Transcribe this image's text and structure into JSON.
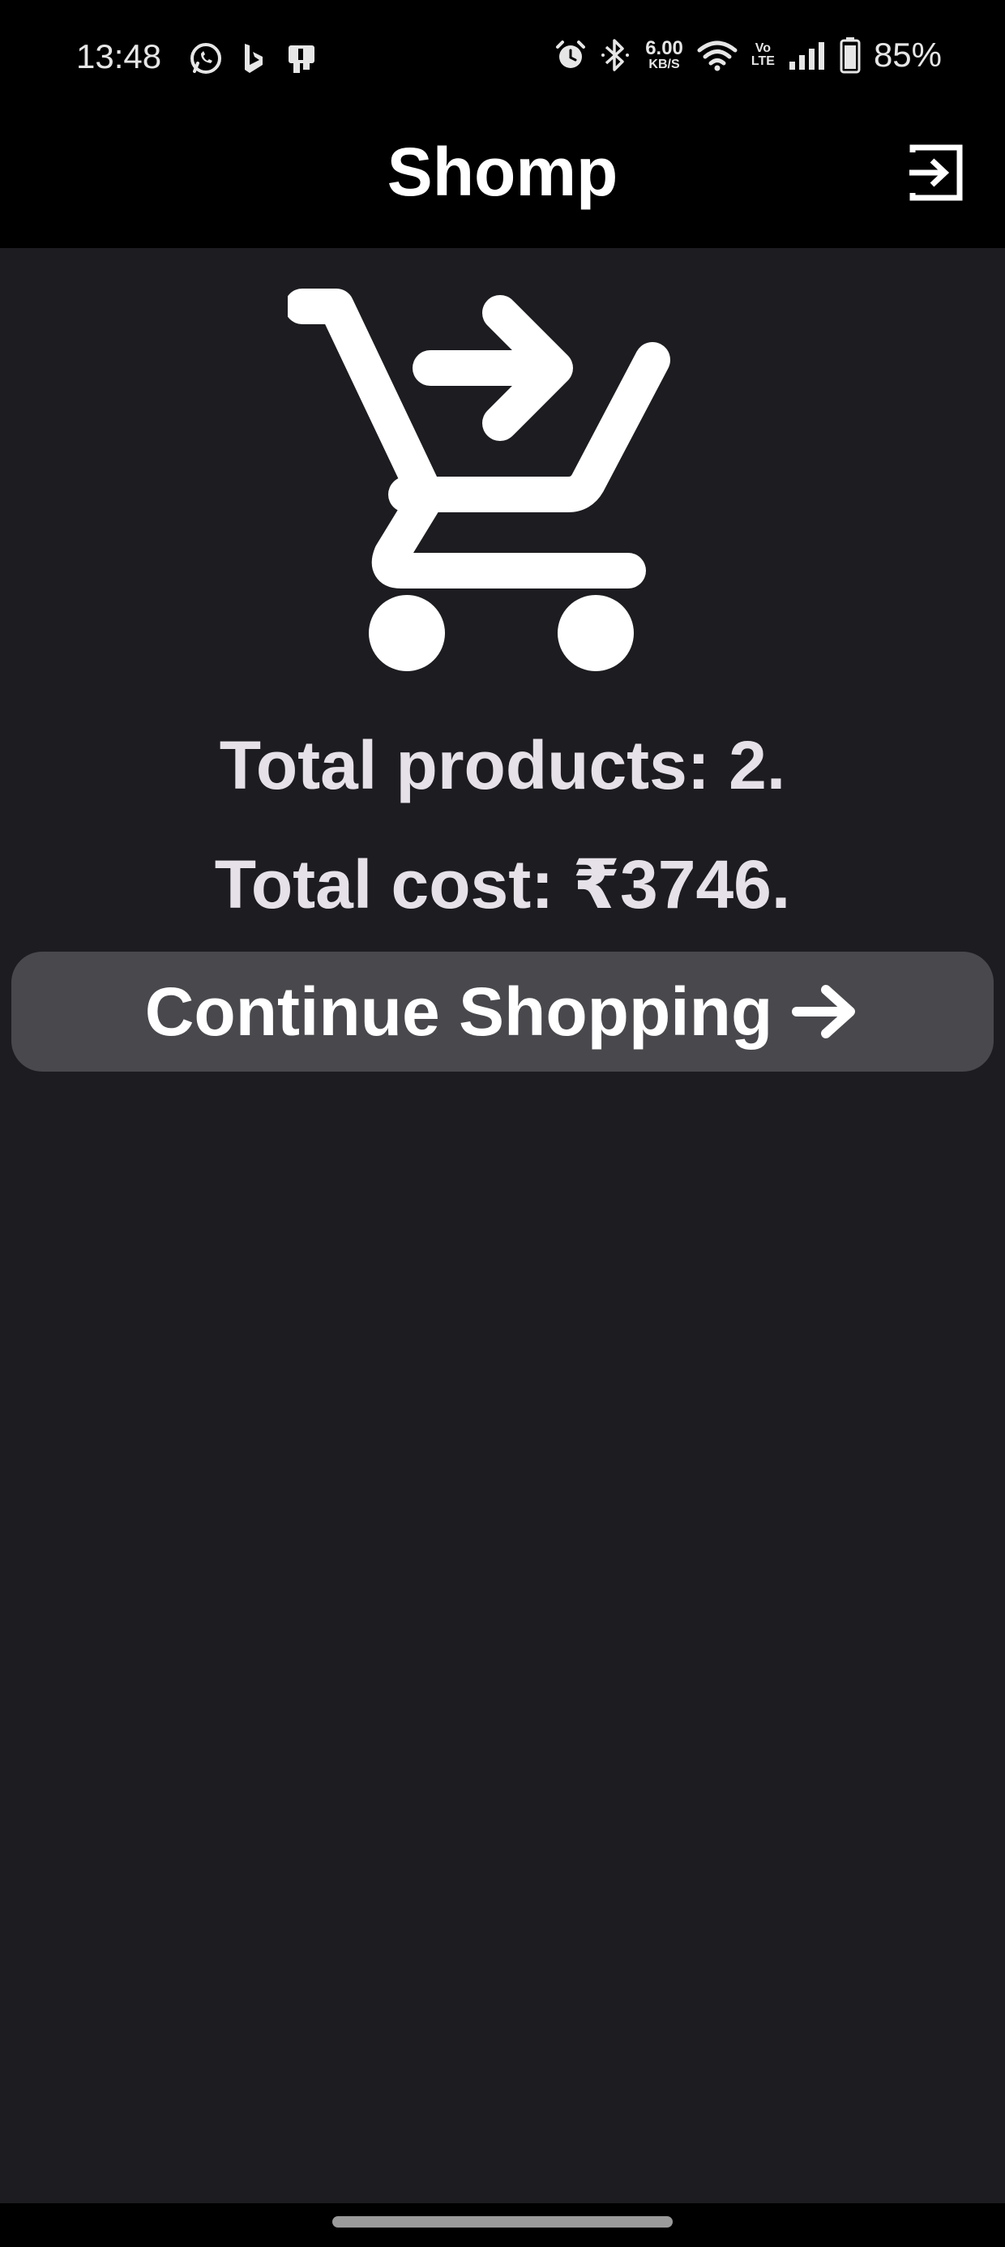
{
  "status_bar": {
    "time": "13:48",
    "left_icons": [
      "whatsapp-icon",
      "bing-icon",
      "notification-app-icon"
    ],
    "right_icons": [
      "alarm-icon",
      "bluetooth-icon",
      "wifi-icon",
      "volte-icon",
      "signal-icon",
      "battery-icon"
    ],
    "net_speed_value": "6.00",
    "net_speed_unit": "KB/S",
    "volte_top": "Vo",
    "volte_bottom": "LTE",
    "battery": "85%"
  },
  "app_bar": {
    "title": "Shomp",
    "action_icon": "logout-icon"
  },
  "main": {
    "illustration_icon": "shopping-cart-checkout-icon",
    "total_products": "Total products: 2.",
    "total_cost": "Total cost: ₹3746.",
    "continue_label": "Continue Shopping",
    "continue_icon": "arrow-right-icon"
  },
  "colors": {
    "background": "#1d1c20",
    "app_bar": "#000000",
    "button": "#49484d",
    "text": "#e6e1e9"
  }
}
